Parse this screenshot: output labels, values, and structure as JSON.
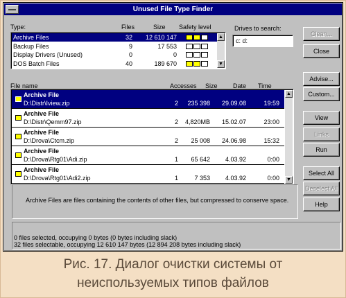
{
  "window": {
    "title": "Unused File Type Finder"
  },
  "types": {
    "header_type": "Type:",
    "header_files": "Files",
    "header_size": "Size",
    "header_safety": "Safety level",
    "rows": [
      {
        "name": "Archive Files",
        "files": "32",
        "size": "12 610 147",
        "safety_filled": 2,
        "selected": true
      },
      {
        "name": "Backup Files",
        "files": "9",
        "size": "17 553",
        "safety_filled": 0,
        "selected": false
      },
      {
        "name": "Display Drivers (Unused)",
        "files": "0",
        "size": "0",
        "safety_filled": 0,
        "selected": false
      },
      {
        "name": "DOS Batch Files",
        "files": "40",
        "size": "189 670",
        "safety_filled": 2,
        "selected": false
      }
    ]
  },
  "drives": {
    "label": "Drives to search:",
    "value": "c: d:"
  },
  "files": {
    "header_name": "File name",
    "header_accesses": "Accesses",
    "header_size": "Size",
    "header_date": "Date",
    "header_time": "Time",
    "rows": [
      {
        "name": "Archive File",
        "path": "D:\\Distr\\Iview.zip",
        "accesses": "2",
        "size": "235 398",
        "date": "29.09.08",
        "time": "19:59",
        "selected": true
      },
      {
        "name": "Archive File",
        "path": "D:\\Distr\\Qemm97.zip",
        "accesses": "2",
        "size": "4,820MB",
        "date": "15.02.07",
        "time": "23:00",
        "selected": false
      },
      {
        "name": "Archive File",
        "path": "D:\\Drova\\Ctcm.zip",
        "accesses": "2",
        "size": "25 008",
        "date": "24.06.98",
        "time": "15:32",
        "selected": false
      },
      {
        "name": "Archive File",
        "path": "D:\\Drova\\Rtg01\\Adi.zip",
        "accesses": "1",
        "size": "65 642",
        "date": "4.03.92",
        "time": "0:00",
        "selected": false
      },
      {
        "name": "Archive File",
        "path": "D:\\Drova\\Rtg01\\Adi2.zip",
        "accesses": "1",
        "size": "7 353",
        "date": "4.03.92",
        "time": "0:00",
        "selected": false
      }
    ]
  },
  "buttons": {
    "clean": "Clean...",
    "close": "Close",
    "advise": "Advise...",
    "custom": "Custom...",
    "view": "View",
    "links": "Links",
    "run": "Run",
    "select_all": "Select All",
    "deselect_all": "Deselect All",
    "help": "Help"
  },
  "description": "Archive Files are files containing the contents of other files, but compressed to conserve space.",
  "status": {
    "line1": "0 files selected, occupying 0 bytes (0 bytes including slack)",
    "line2": "32 files selectable, occupying 12 610 147 bytes (12 894 208 bytes including slack)"
  },
  "caption": {
    "line1": "Рис. 17. Диалог очистки системы от",
    "line2": "неиспользуемых типов файлов"
  },
  "colors": {
    "titlebar": "#000080",
    "selection": "#000080",
    "face": "#c0c0c0",
    "safety_fill": "#ffff00",
    "page_background": "#f4dfc4"
  }
}
